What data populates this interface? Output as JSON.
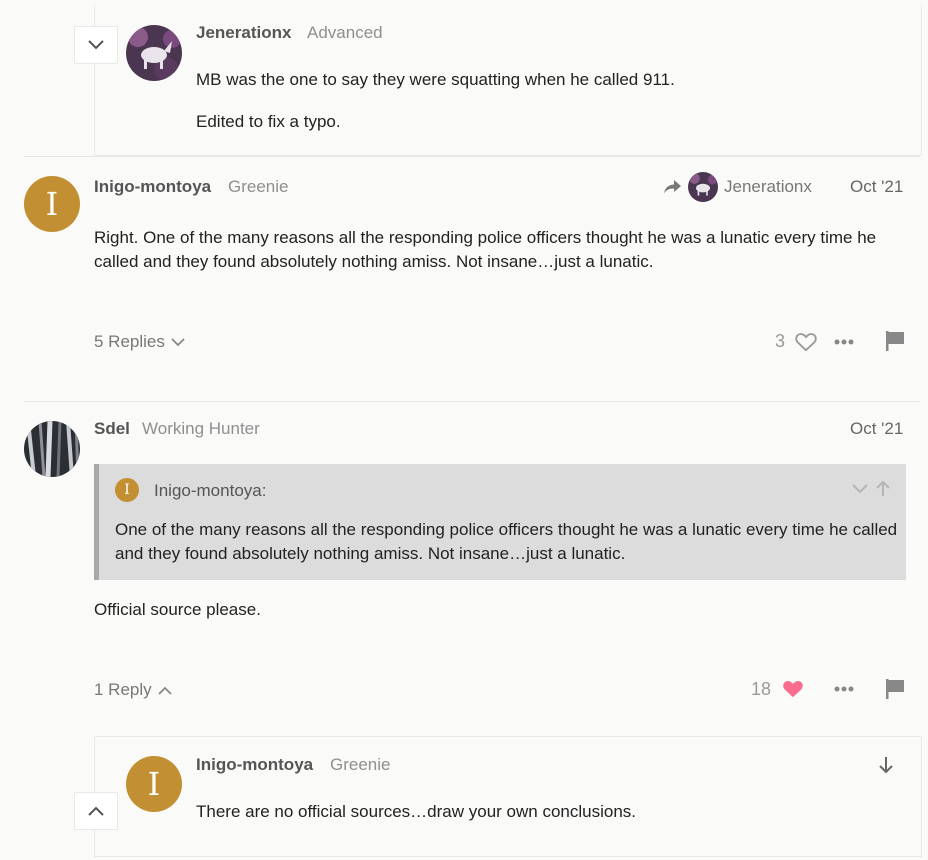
{
  "embedded_reply_top": {
    "username": "Jenerationx",
    "user_title": "Advanced",
    "paragraphs": [
      "MB was the one to say they were squatting when he called 911.",
      "Edited to fix a typo."
    ]
  },
  "post1": {
    "username": "Inigo-montoya",
    "user_title": "Greenie",
    "avatar_letter": "I",
    "reply_to_username": "Jenerationx",
    "date": "Oct '21",
    "body": "Right. One of the many reasons all the responding police officers thought he was a lunatic every time he called and they found absolutely nothing amiss. Not insane…just a lunatic.",
    "replies_label": "5 Replies",
    "like_count": "3"
  },
  "post2": {
    "username": "Sdel",
    "user_title": "Working Hunter",
    "date": "Oct '21",
    "quote": {
      "avatar_letter": "I",
      "username": "Inigo-montoya:",
      "text": "One of the many reasons all the responding police officers thought he was a lunatic every time he called and they found absolutely nothing amiss. Not insane…just a lunatic."
    },
    "body": "Official source please.",
    "replies_label": "1 Reply",
    "like_count": "18"
  },
  "embedded_reply_bottom": {
    "username": "Inigo-montoya",
    "user_title": "Greenie",
    "avatar_letter": "I",
    "body": "There are no official sources…draw your own conclusions."
  },
  "colors": {
    "avatar_brown": "#c28f32",
    "like_active": "#fa6c8d",
    "quote_bg": "#dcdcdc"
  }
}
